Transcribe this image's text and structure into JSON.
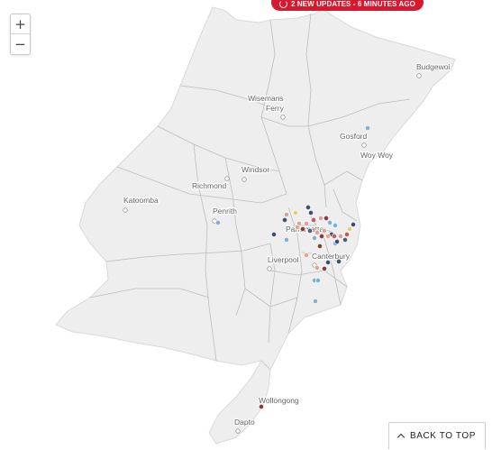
{
  "banner": {
    "text": "2 NEW UPDATES - 6 MINUTES AGO"
  },
  "zoom": {
    "in_label": "+",
    "out_label": "−"
  },
  "back_to_top": {
    "label": "BACK TO TOP"
  },
  "colors": {
    "land": "#eeeeee",
    "boundary": "#bdbdbd",
    "banner": "#d8182e"
  },
  "places": [
    {
      "id": "budgewoi",
      "name": "Budgewoi"
    },
    {
      "id": "wisemans",
      "name": "Wisemans Ferry"
    },
    {
      "id": "gosford",
      "name": "Gosford"
    },
    {
      "id": "woyway",
      "name": "Woy Woy"
    },
    {
      "id": "windsor",
      "name": "Windsor"
    },
    {
      "id": "richmond",
      "name": "Richmond"
    },
    {
      "id": "katoomba",
      "name": "Katoomba"
    },
    {
      "id": "penrith",
      "name": "Penrith"
    },
    {
      "id": "parramatta",
      "name": "Parramatta"
    },
    {
      "id": "liverpool",
      "name": "Liverpool"
    },
    {
      "id": "canterbury",
      "name": "Canterbury"
    },
    {
      "id": "wollongong",
      "name": "Wollongong"
    },
    {
      "id": "dapto",
      "name": "Dapto"
    }
  ],
  "marker_palette": [
    "#d9a0a0",
    "#7fb0d9",
    "#3d4f75",
    "#8a3a3a",
    "#d8d07a",
    "#c45a5a",
    "#e2a88a",
    "#555b70"
  ]
}
